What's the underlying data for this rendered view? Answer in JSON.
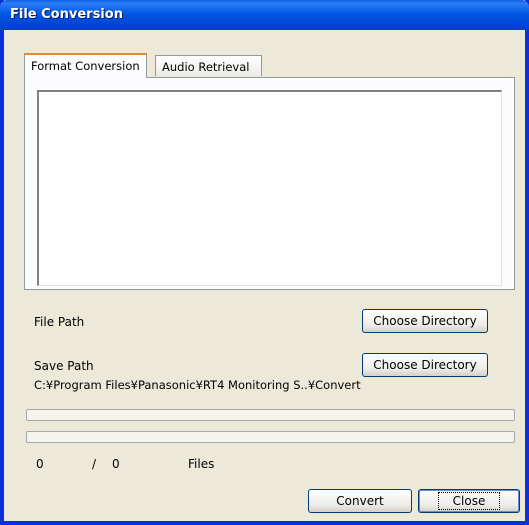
{
  "window": {
    "title": "File Conversion"
  },
  "tabs": [
    {
      "label": "Format Conversion",
      "active": true
    },
    {
      "label": "Audio Retrieval",
      "active": false
    }
  ],
  "file_path": {
    "label": "File Path",
    "button_label": "Choose Directory"
  },
  "save_path": {
    "label": "Save Path",
    "button_label": "Choose Directory",
    "value": "C:¥Program Files¥Panasonic¥RT4 Monitoring S..¥Convert"
  },
  "progress": {
    "bar1_fraction": 0,
    "bar2_fraction": 0,
    "count_done": "0",
    "separator": "/",
    "count_total": "0",
    "unit": "Files"
  },
  "buttons": {
    "convert": "Convert",
    "close": "Close"
  },
  "colors": {
    "titlebar": "#0058e6",
    "window_bg": "#ece9d8",
    "border": "#0831d9"
  }
}
